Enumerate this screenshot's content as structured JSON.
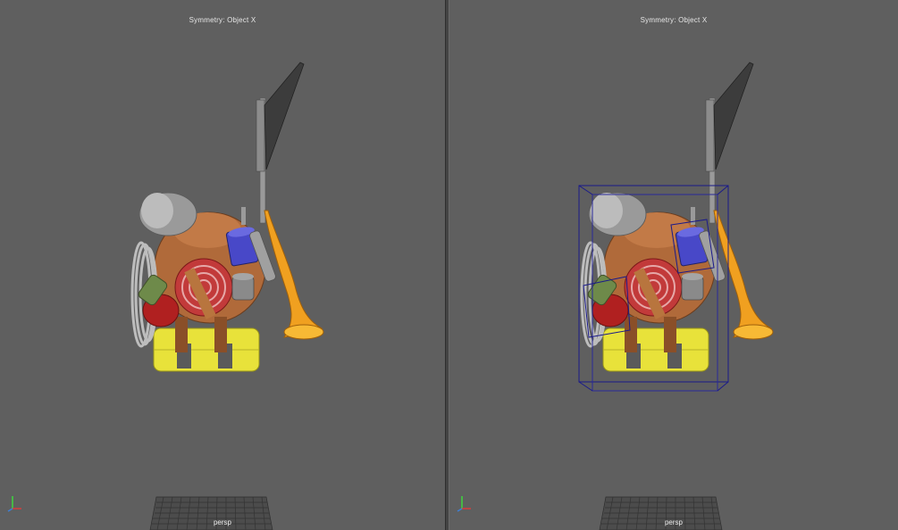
{
  "viewports": [
    {
      "hud_title": "Symmetry: Object X",
      "camera_label": "persp",
      "bounding_box": false
    },
    {
      "hud_title": "Symmetry: Object X",
      "camera_label": "persp",
      "bounding_box": true
    }
  ],
  "icons": {
    "axis": "axis-gizmo-icon",
    "grid": "ground-grid-icon"
  },
  "colors": {
    "viewport_bg": "#5f5f5f",
    "selection_box": "#1a1a6e",
    "backpack_orange": "#b06a3a",
    "yellow": "#e8e23a",
    "horn_orange": "#f0a020",
    "cup_blue": "#4848c8",
    "red_bag": "#b02020",
    "green_canteen": "#6e8a4a"
  }
}
